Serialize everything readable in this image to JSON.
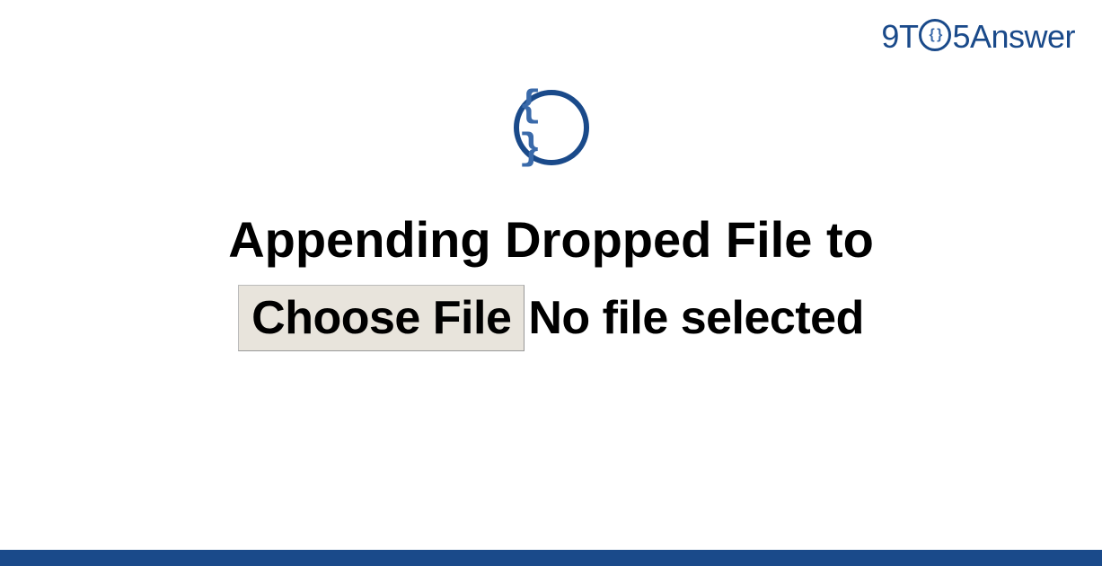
{
  "logo": {
    "part1": "9T",
    "circle_inner": "{ }",
    "part2": "5Answer"
  },
  "icon": {
    "braces": "{ }"
  },
  "title": {
    "line1": "Appending Dropped File to"
  },
  "file_input": {
    "button_label": "Choose File",
    "status_text": "No file selected"
  }
}
